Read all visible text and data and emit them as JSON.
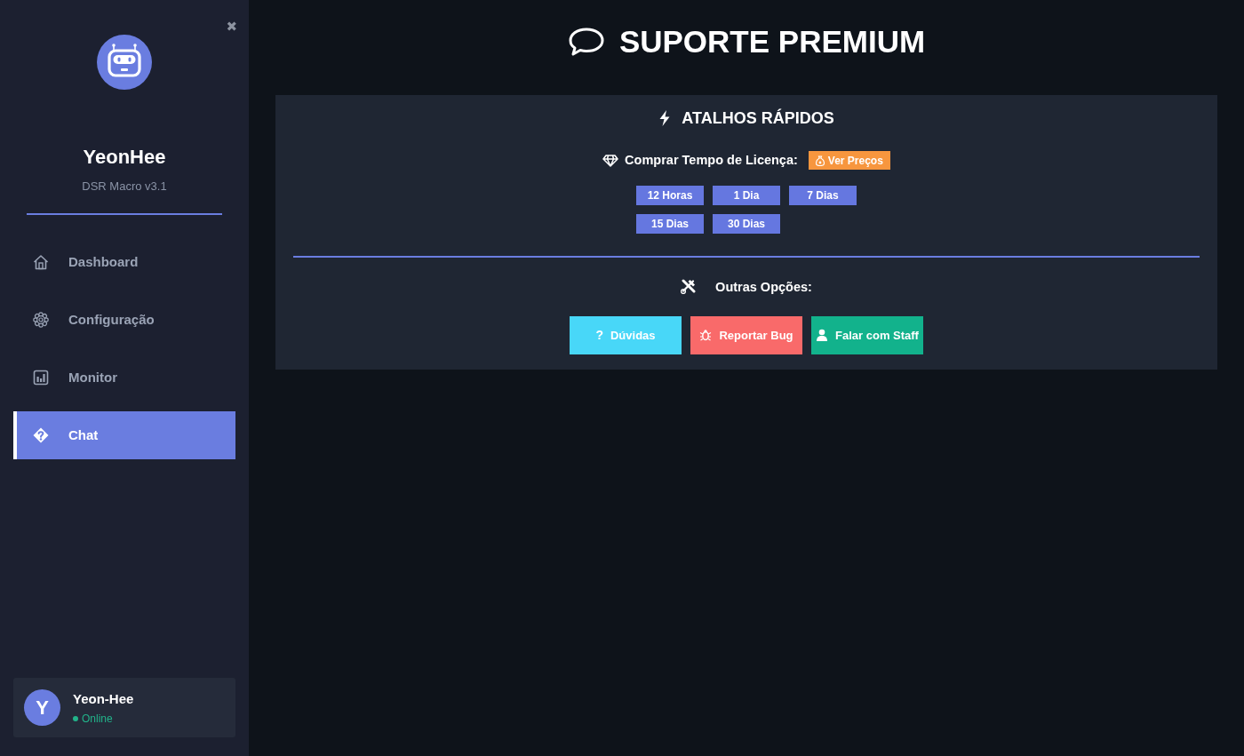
{
  "sidebar": {
    "close": "✖",
    "app_name": "YeonHee",
    "version": "DSR Macro v3.1",
    "items": [
      {
        "label": "Dashboard",
        "selected": false
      },
      {
        "label": "Configuração",
        "selected": false
      },
      {
        "label": "Monitor",
        "selected": false
      },
      {
        "label": "Chat",
        "selected": true
      }
    ],
    "user": {
      "initial": "Y",
      "name": "Yeon-Hee",
      "status": "Online"
    }
  },
  "header": {
    "title": "SUPORTE PREMIUM"
  },
  "shortcuts": {
    "title": "ATALHOS RÁPIDOS",
    "license_label": "Comprar Tempo de Licença:",
    "prices_button": "Ver Preços",
    "durations": [
      "12 Horas",
      "1 Dia",
      "7 Dias",
      "15 Dias",
      "30 Dias"
    ],
    "other_label": "Outras Opções:",
    "actions": [
      {
        "label": "Dúvidas",
        "glyph": "?",
        "color": "#48d7f8"
      },
      {
        "label": "Reportar Bug",
        "color": "#f96a6a"
      },
      {
        "label": "Falar com Staff",
        "color": "#12b28c"
      }
    ]
  }
}
